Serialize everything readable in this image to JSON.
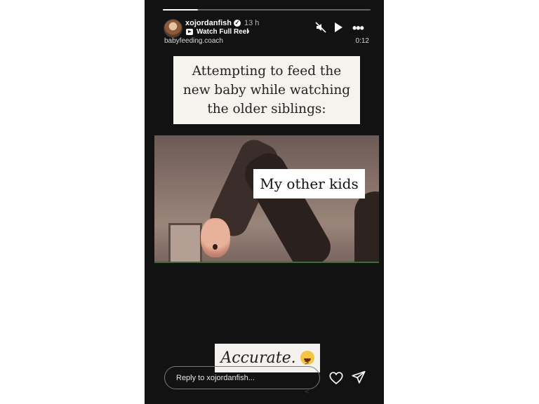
{
  "story": {
    "username": "xojordanfish",
    "time_ago": "13 h",
    "watch_reel_label": "Watch Full Reel",
    "reel_chevron": "›",
    "audio_source": "babyfeeding.coach",
    "duration": "0:12",
    "progress": 0.17
  },
  "content": {
    "caption": "Attempting to feed the new baby while watching the older siblings:",
    "video_label": "My other kids",
    "sticker_text": "Accurate."
  },
  "footer": {
    "reply_placeholder": "Reply to xojordanfish..."
  },
  "icons": {
    "verified": "verified-badge-icon",
    "mute": "muted-speaker-icon",
    "play": "play-icon",
    "more": "more-dots-icon",
    "heart": "heart-icon",
    "send": "send-icon",
    "emoji": "grinning-squinting-face-emoji"
  },
  "colors": {
    "story_background": "#121212",
    "caption_background": "#f5f3ee",
    "text_light": "#ffffff"
  }
}
